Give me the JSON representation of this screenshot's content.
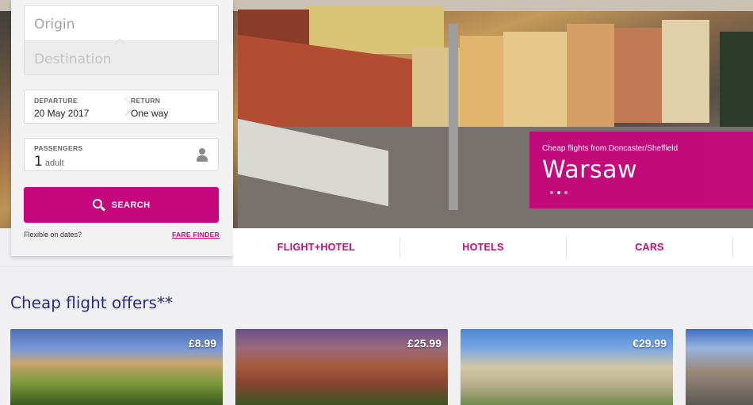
{
  "search": {
    "origin_placeholder": "Origin",
    "destination_placeholder": "Destination",
    "departure_label": "DEPARTURE",
    "departure_value": "20 May 2017",
    "return_label": "RETURN",
    "return_value": "One way",
    "passengers_label": "PASSENGERS",
    "passengers_count": "1",
    "passengers_unit": "adult",
    "search_label": "SEARCH",
    "flexible_text": "Flexible on dates?",
    "fare_finder_label": "FARE FINDER",
    "icons": {
      "passenger": "person-icon",
      "search": "search-icon"
    }
  },
  "hero": {
    "subtitle": "Cheap flights from Doncaster/Sheffield",
    "city": "Warsaw",
    "slides_total": 3,
    "slide_active": 2
  },
  "tabs": [
    "FLIGHT+HOTEL",
    "HOTELS",
    "CARS"
  ],
  "offers": {
    "title": "Cheap flight offers**",
    "cards": [
      {
        "price": "£8.99"
      },
      {
        "price": "£25.99"
      },
      {
        "price": "€29.99"
      },
      {
        "price": ""
      }
    ]
  },
  "colors": {
    "brand": "#c6067c",
    "heading": "#2a2a82"
  }
}
